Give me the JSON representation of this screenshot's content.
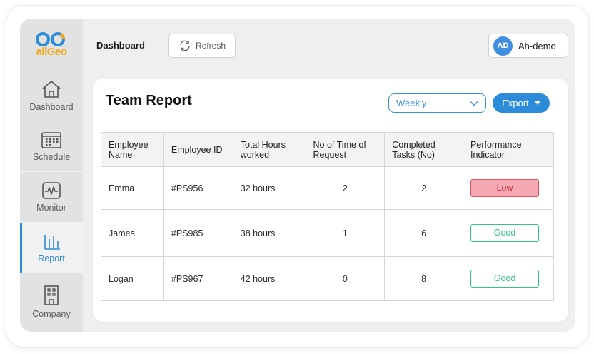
{
  "brand": {
    "logo_text": "allGeo",
    "accent": "#2d8cd9",
    "logo_orange": "#f2a81d"
  },
  "sidebar": {
    "items": [
      {
        "label": "Dashboard",
        "icon": "home-icon",
        "active": false
      },
      {
        "label": "Schedule",
        "icon": "calendar-icon",
        "active": false
      },
      {
        "label": "Monitor",
        "icon": "monitor-pulse-icon",
        "active": false
      },
      {
        "label": "Report",
        "icon": "bar-chart-icon",
        "active": true
      },
      {
        "label": "Company",
        "icon": "building-icon",
        "active": false
      }
    ]
  },
  "header": {
    "title": "Dashboard",
    "refresh_label": "Refresh",
    "user": {
      "initials": "AD",
      "name": "Ah-demo"
    }
  },
  "report": {
    "title": "Team Report",
    "period": "Weekly",
    "export_label": "Export",
    "columns": [
      "Employee Name",
      "Employee ID",
      "Total Hours worked",
      "No of Time of Request",
      "Completed Tasks (No)",
      "Performance Indicator"
    ],
    "rows": [
      {
        "name": "Emma",
        "id": "#PS956",
        "hours": "32 hours",
        "time_off": "2",
        "tasks": "2",
        "performance": "Low"
      },
      {
        "name": "James",
        "id": "#PS985",
        "hours": "38 hours",
        "time_off": "1",
        "tasks": "6",
        "performance": "Good"
      },
      {
        "name": "Logan",
        "id": "#PS967",
        "hours": "42 hours",
        "time_off": "0",
        "tasks": "8",
        "performance": "Good"
      }
    ],
    "status_colors": {
      "low": "#f6a9b3",
      "good": "#32c488"
    }
  }
}
